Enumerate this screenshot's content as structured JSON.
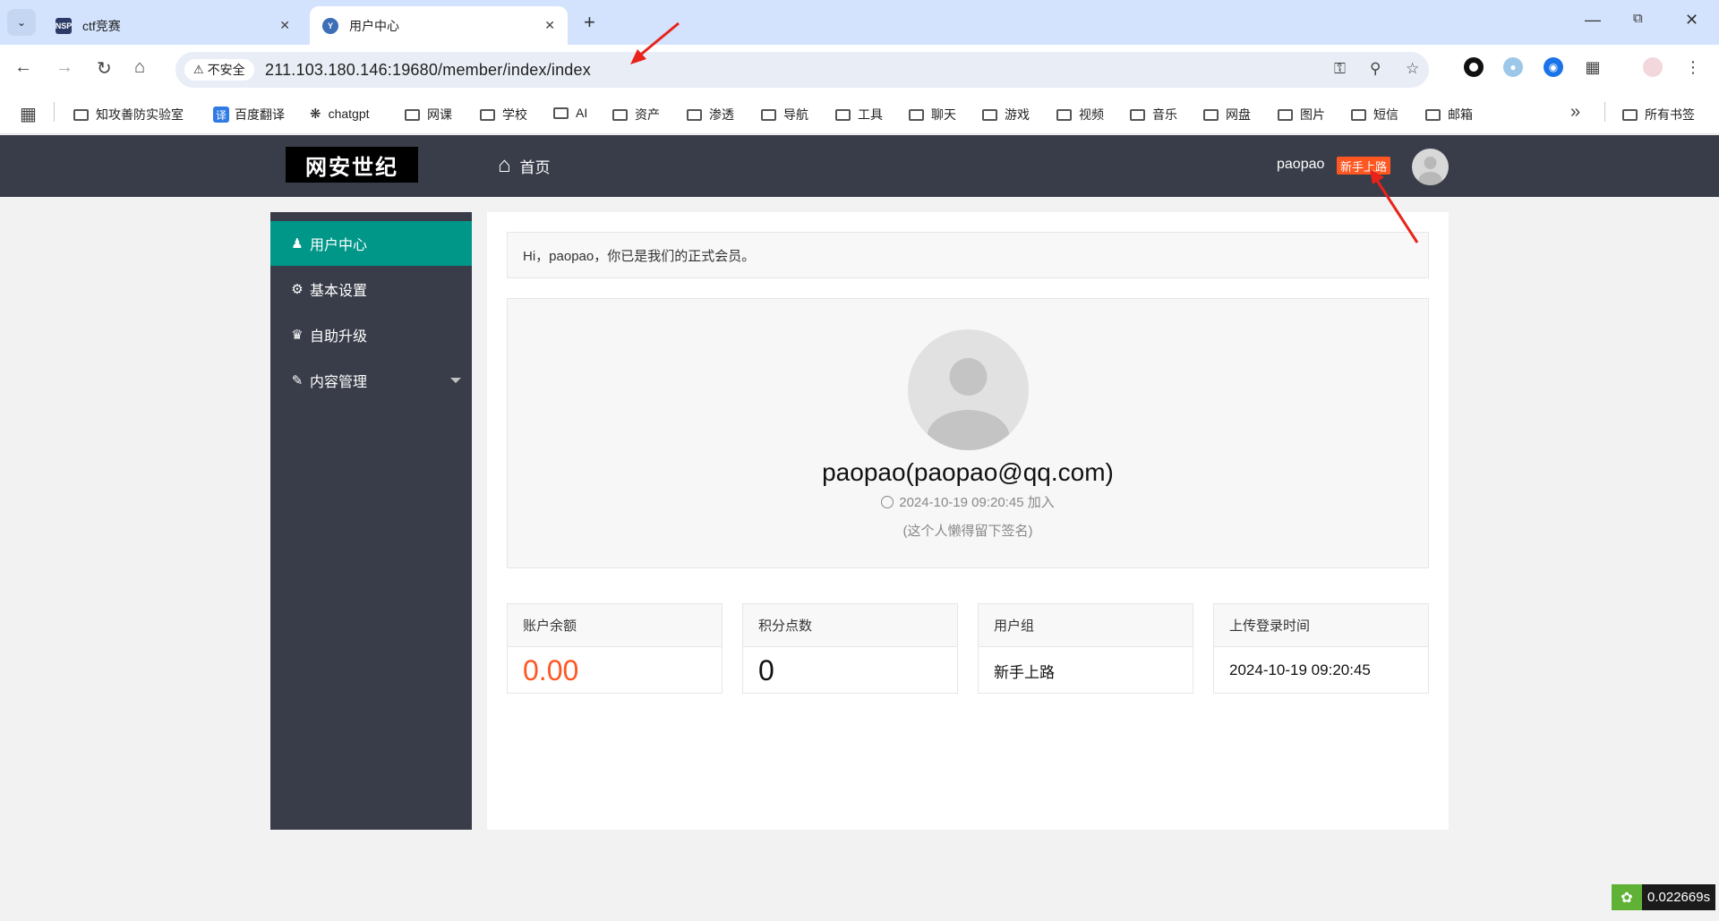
{
  "browser": {
    "tabs": [
      {
        "title": "ctf竞赛",
        "favicon": "NSP",
        "active": false
      },
      {
        "title": "用户中心",
        "favicon": "Y",
        "active": true
      }
    ],
    "address": {
      "security_label": "不安全",
      "url": "211.103.180.146:19680/member/index/index"
    },
    "bookmarks": [
      {
        "label": "知攻善防实验室",
        "icon": "folder-icon"
      },
      {
        "label": "百度翻译",
        "icon": "translate-icon",
        "badge": "译"
      },
      {
        "label": "chatgpt",
        "icon": "chatgpt-icon"
      },
      {
        "label": "网课",
        "icon": "folder-icon"
      },
      {
        "label": "学校",
        "icon": "folder-icon"
      },
      {
        "label": "AI",
        "icon": "folder-icon"
      },
      {
        "label": "资产",
        "icon": "folder-icon"
      },
      {
        "label": "渗透",
        "icon": "folder-icon"
      },
      {
        "label": "导航",
        "icon": "folder-icon"
      },
      {
        "label": "工具",
        "icon": "folder-icon"
      },
      {
        "label": "聊天",
        "icon": "folder-icon"
      },
      {
        "label": "游戏",
        "icon": "folder-icon"
      },
      {
        "label": "视频",
        "icon": "folder-icon"
      },
      {
        "label": "音乐",
        "icon": "folder-icon"
      },
      {
        "label": "网盘",
        "icon": "folder-icon"
      },
      {
        "label": "图片",
        "icon": "folder-icon"
      },
      {
        "label": "短信",
        "icon": "folder-icon"
      },
      {
        "label": "邮箱",
        "icon": "folder-icon"
      }
    ],
    "all_bookmarks": "所有书签"
  },
  "site": {
    "logo": "网安世纪",
    "home_label": "首页",
    "username": "paopao",
    "user_badge": "新手上路"
  },
  "sidebar": {
    "items": [
      {
        "label": "用户中心",
        "icon": "user-icon",
        "active": true
      },
      {
        "label": "基本设置",
        "icon": "settings-icon",
        "active": false
      },
      {
        "label": "自助升级",
        "icon": "crown-icon",
        "active": false
      },
      {
        "label": "内容管理",
        "icon": "document-icon",
        "active": false,
        "has_submenu": true
      }
    ]
  },
  "main": {
    "greeting": "Hi，paopao，你已是我们的正式会员。",
    "profile": {
      "display": "paopao(paopao@qq.com)",
      "joined_time": "2024-10-19 09:20:45",
      "joined_suffix": "加入",
      "signature": "(这个人懒得留下签名)"
    },
    "stats": [
      {
        "label": "账户余额",
        "value": "0.00"
      },
      {
        "label": "积分点数",
        "value": "0"
      },
      {
        "label": "用户组",
        "value": "新手上路"
      },
      {
        "label": "上传登录时间",
        "value": "2024-10-19 09:20:45"
      }
    ]
  },
  "overlay": {
    "timer": "0.022669s"
  },
  "colors": {
    "header_bg": "#393d49",
    "sidebar_active": "#009688",
    "accent_orange": "#ff5722",
    "annotation_red": "#e8231a"
  }
}
